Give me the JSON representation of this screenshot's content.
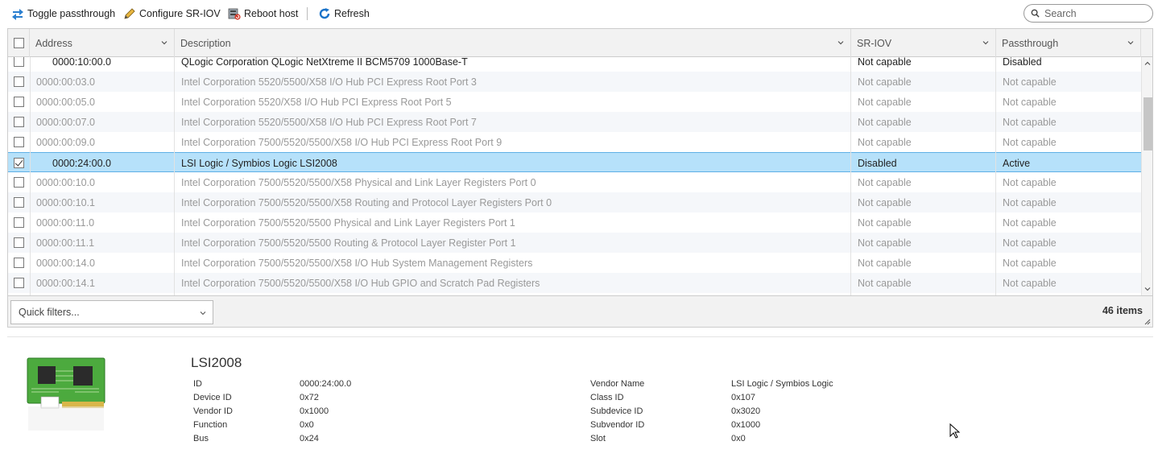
{
  "toolbar": {
    "toggle_passthrough": "Toggle passthrough",
    "configure_sriov": "Configure SR-IOV",
    "reboot_host": "Reboot host",
    "refresh": "Refresh",
    "search_placeholder": "Search"
  },
  "columns": {
    "address": "Address",
    "description": "Description",
    "sriov": "SR-IOV",
    "passthrough": "Passthrough"
  },
  "rows": [
    {
      "address": "0000:10:00.0",
      "description": "QLogic Corporation QLogic NetXtreme II BCM5709 1000Base-T",
      "sriov": "Not capable",
      "passthrough": "Disabled",
      "active": true,
      "selected": false
    },
    {
      "address": "0000:00:03.0",
      "description": "Intel Corporation 5520/5500/X58 I/O Hub PCI Express Root Port 3",
      "sriov": "Not capable",
      "passthrough": "Not capable",
      "active": false,
      "selected": false
    },
    {
      "address": "0000:00:05.0",
      "description": "Intel Corporation 5520/X58 I/O Hub PCI Express Root Port 5",
      "sriov": "Not capable",
      "passthrough": "Not capable",
      "active": false,
      "selected": false
    },
    {
      "address": "0000:00:07.0",
      "description": "Intel Corporation 5520/5500/X58 I/O Hub PCI Express Root Port 7",
      "sriov": "Not capable",
      "passthrough": "Not capable",
      "active": false,
      "selected": false
    },
    {
      "address": "0000:00:09.0",
      "description": "Intel Corporation 7500/5520/5500/X58 I/O Hub PCI Express Root Port 9",
      "sriov": "Not capable",
      "passthrough": "Not capable",
      "active": false,
      "selected": false
    },
    {
      "address": "0000:24:00.0",
      "description": "LSI Logic / Symbios Logic LSI2008",
      "sriov": "Disabled",
      "passthrough": "Active",
      "active": true,
      "selected": true
    },
    {
      "address": "0000:00:10.0",
      "description": "Intel Corporation 7500/5520/5500/X58 Physical and Link Layer Registers Port 0",
      "sriov": "Not capable",
      "passthrough": "Not capable",
      "active": false,
      "selected": false
    },
    {
      "address": "0000:00:10.1",
      "description": "Intel Corporation 7500/5520/5500/X58 Routing and Protocol Layer Registers Port 0",
      "sriov": "Not capable",
      "passthrough": "Not capable",
      "active": false,
      "selected": false
    },
    {
      "address": "0000:00:11.0",
      "description": "Intel Corporation 7500/5520/5500 Physical and Link Layer Registers Port 1",
      "sriov": "Not capable",
      "passthrough": "Not capable",
      "active": false,
      "selected": false
    },
    {
      "address": "0000:00:11.1",
      "description": "Intel Corporation 7500/5520/5500 Routing & Protocol Layer Register Port 1",
      "sriov": "Not capable",
      "passthrough": "Not capable",
      "active": false,
      "selected": false
    },
    {
      "address": "0000:00:14.0",
      "description": "Intel Corporation 7500/5520/5500/X58 I/O Hub System Management Registers",
      "sriov": "Not capable",
      "passthrough": "Not capable",
      "active": false,
      "selected": false
    },
    {
      "address": "0000:00:14.1",
      "description": "Intel Corporation 7500/5520/5500/X58 I/O Hub GPIO and Scratch Pad Registers",
      "sriov": "Not capable",
      "passthrough": "Not capable",
      "active": false,
      "selected": false
    }
  ],
  "footer": {
    "quick_filters": "Quick filters...",
    "item_count": "46 items"
  },
  "details": {
    "title": "LSI2008",
    "left": [
      {
        "key": "ID",
        "value": "0000:24:00.0"
      },
      {
        "key": "Device ID",
        "value": "0x72"
      },
      {
        "key": "Vendor ID",
        "value": "0x1000"
      },
      {
        "key": "Function",
        "value": "0x0"
      },
      {
        "key": "Bus",
        "value": "0x24"
      }
    ],
    "right": [
      {
        "key": "Vendor Name",
        "value": "LSI Logic / Symbios Logic"
      },
      {
        "key": "Class ID",
        "value": "0x107"
      },
      {
        "key": "Subdevice ID",
        "value": "0x3020"
      },
      {
        "key": "Subvendor ID",
        "value": "0x1000"
      },
      {
        "key": "Slot",
        "value": "0x0"
      }
    ]
  },
  "icons": {
    "toggle": "toggle-passthrough-icon",
    "configure": "pencil-icon",
    "reboot": "reboot-host-icon",
    "refresh": "refresh-icon",
    "search": "search-icon",
    "device": "pci-card-icon"
  },
  "colors": {
    "selected_row": "#b6e1fa",
    "selected_border": "#5fb0e6",
    "accent_blue": "#1a73c9",
    "dim_text": "#999999"
  }
}
